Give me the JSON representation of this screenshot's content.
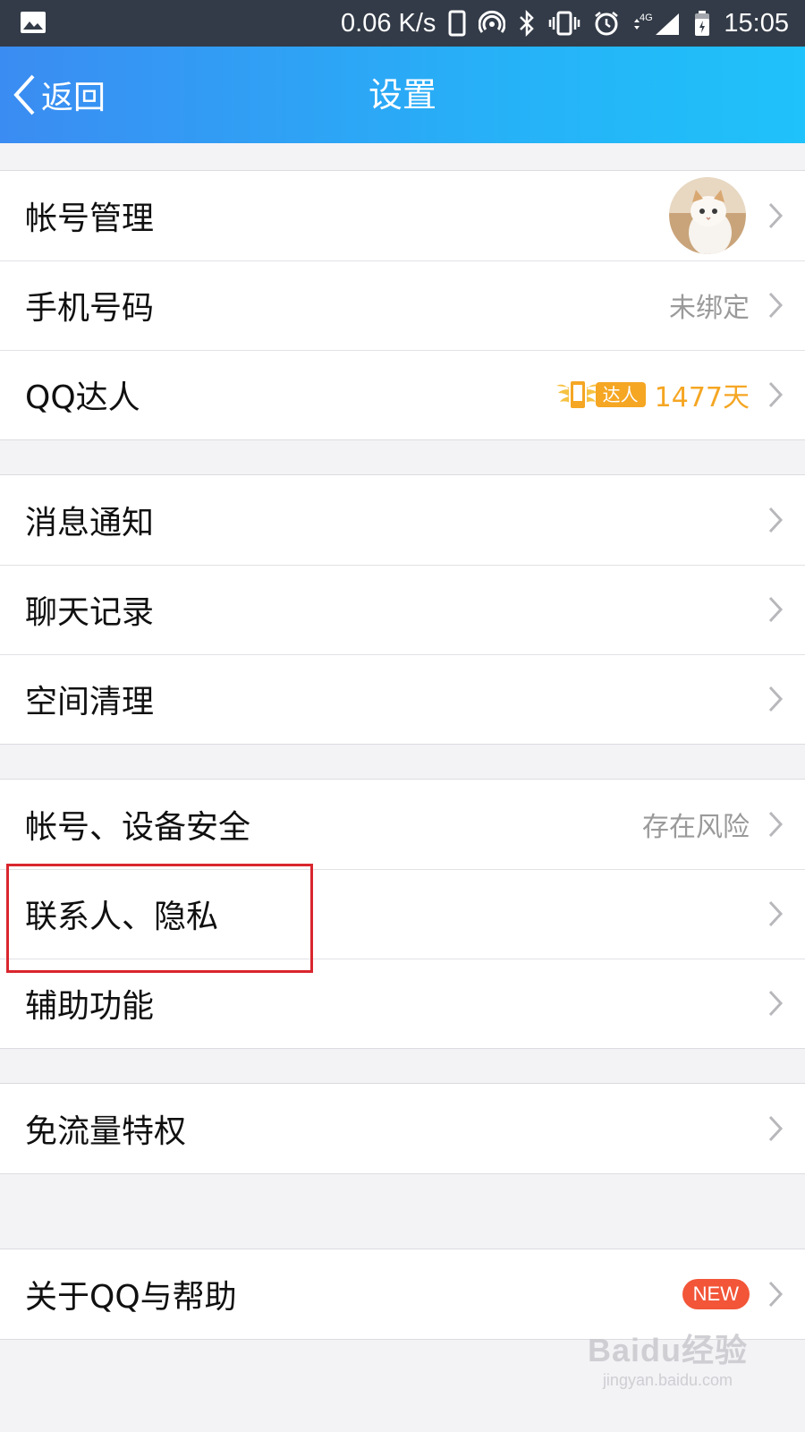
{
  "status_bar": {
    "speed": "0.06 K/s",
    "network": "4G",
    "time": "15:05"
  },
  "header": {
    "back_label": "返回",
    "title": "设置"
  },
  "groups": [
    {
      "rows": [
        {
          "label": "帐号管理",
          "value": "",
          "extra": "avatar"
        },
        {
          "label": "手机号码",
          "value": "未绑定"
        },
        {
          "label": "QQ达人",
          "value": "1477天",
          "badge": "达人"
        }
      ]
    },
    {
      "rows": [
        {
          "label": "消息通知",
          "value": ""
        },
        {
          "label": "聊天记录",
          "value": ""
        },
        {
          "label": "空间清理",
          "value": ""
        }
      ]
    },
    {
      "rows": [
        {
          "label": "帐号、设备安全",
          "value": "存在风险"
        },
        {
          "label": "联系人、隐私",
          "value": ""
        },
        {
          "label": "辅助功能",
          "value": ""
        }
      ]
    },
    {
      "rows": [
        {
          "label": "免流量特权",
          "value": ""
        }
      ]
    },
    {
      "rows": [
        {
          "label": "关于QQ与帮助",
          "badge": "NEW"
        }
      ]
    }
  ],
  "watermark": {
    "logo": "Baidu经验",
    "url": "jingyan.baidu.com"
  },
  "colors": {
    "header_gradient_start": "#3b8cf2",
    "header_gradient_end": "#1fc2fa",
    "value_orange": "#f5a623",
    "new_badge": "#f25538",
    "highlight_box": "#d9262e"
  }
}
